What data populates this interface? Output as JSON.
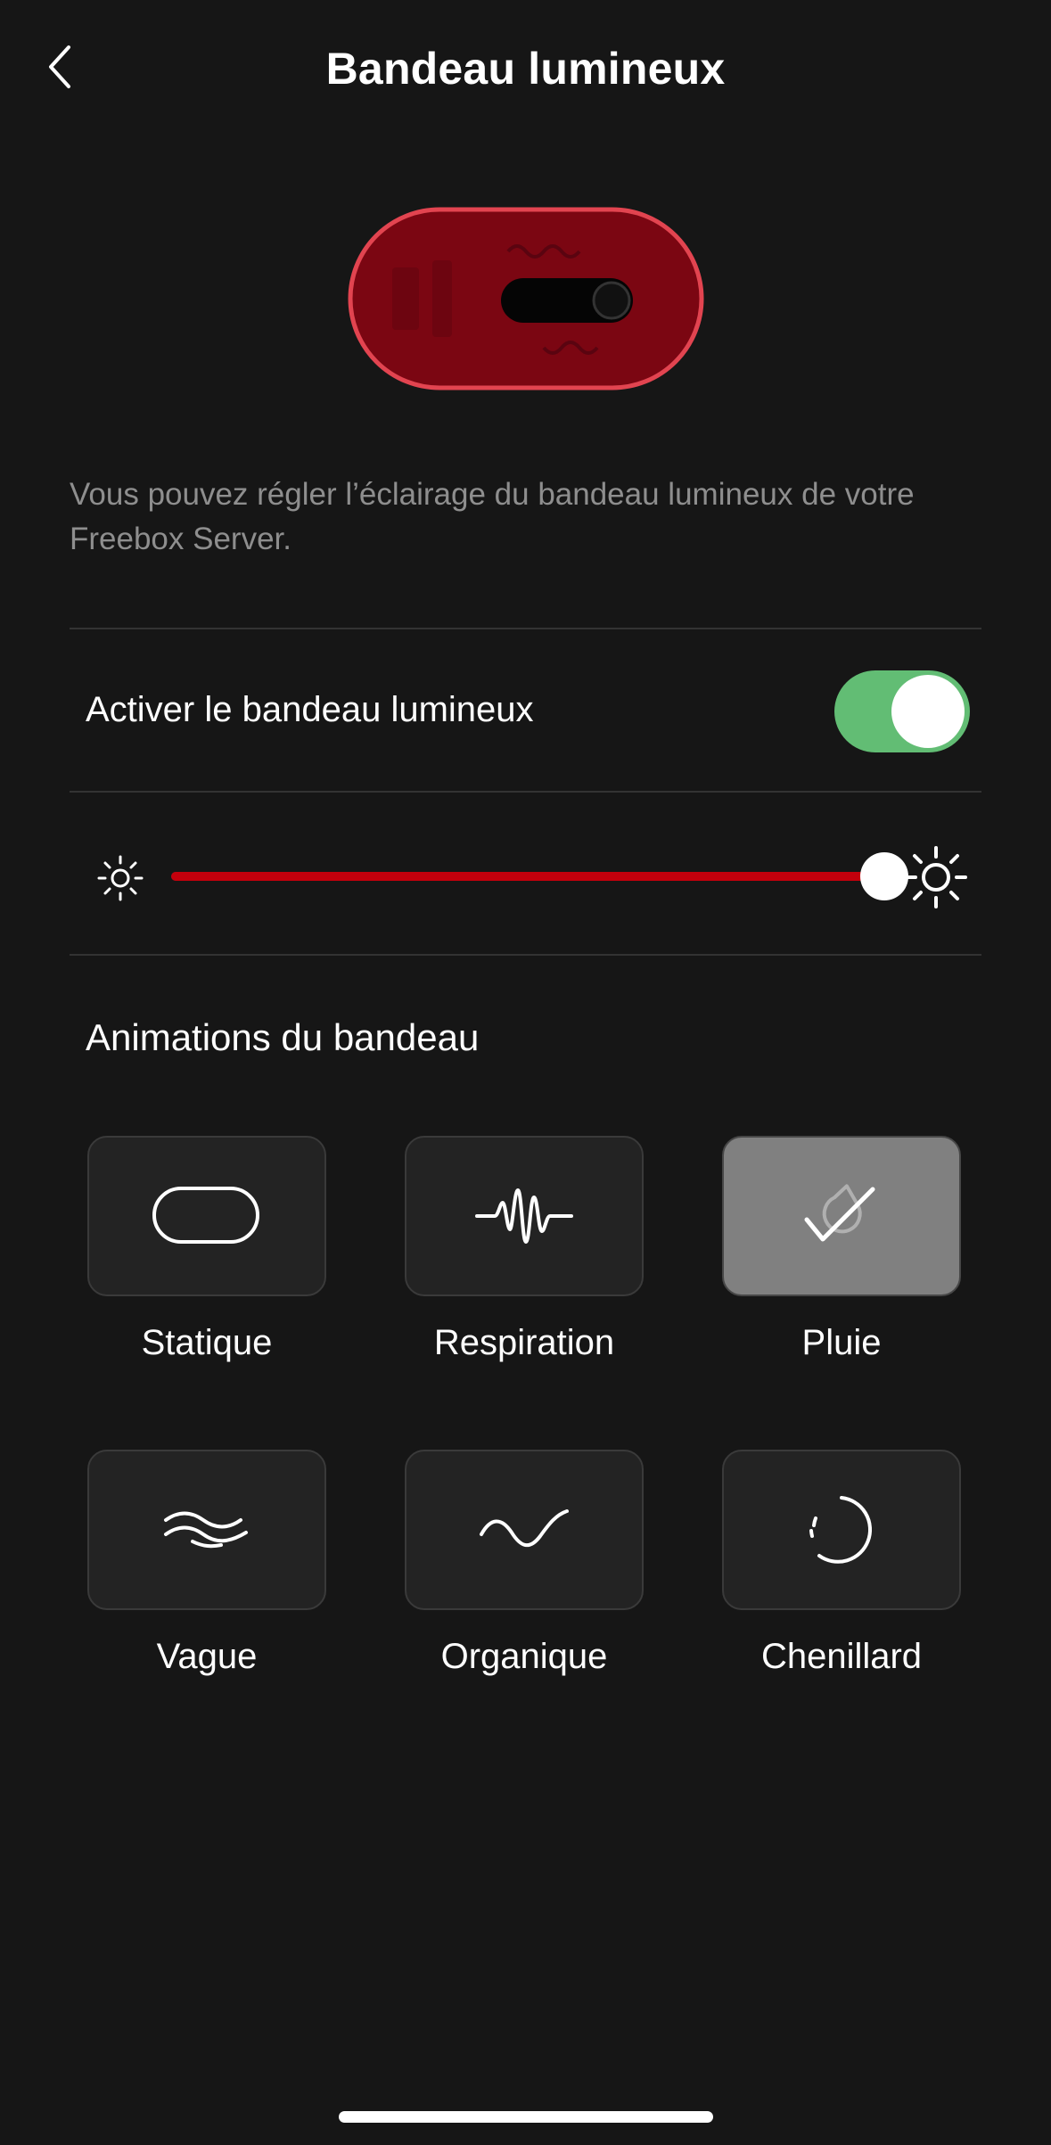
{
  "header": {
    "title": "Bandeau lumineux",
    "back_icon": "chevron-left-icon"
  },
  "device": {
    "image": "freebox-server-led-band",
    "color": "#b0101e"
  },
  "description": "Vous pouvez régler l’éclairage du bandeau lumineux de votre Freebox Server.",
  "toggle": {
    "label": "Activer le bandeau lumineux",
    "enabled": true,
    "color": "#62bd74"
  },
  "brightness": {
    "value": 1.0,
    "min_icon": "sun-small-icon",
    "max_icon": "sun-large-icon",
    "fill_color": "#c4000c"
  },
  "animations": {
    "title": "Animations du bandeau",
    "selected": "Pluie",
    "items": [
      {
        "label": "Statique",
        "icon": "rounded-rect-icon"
      },
      {
        "label": "Respiration",
        "icon": "waveform-icon"
      },
      {
        "label": "Pluie",
        "icon": "raindrop-check-icon"
      },
      {
        "label": "Vague",
        "icon": "waves-icon"
      },
      {
        "label": "Organique",
        "icon": "sine-curve-icon"
      },
      {
        "label": "Chenillard",
        "icon": "loading-circle-icon"
      }
    ]
  }
}
